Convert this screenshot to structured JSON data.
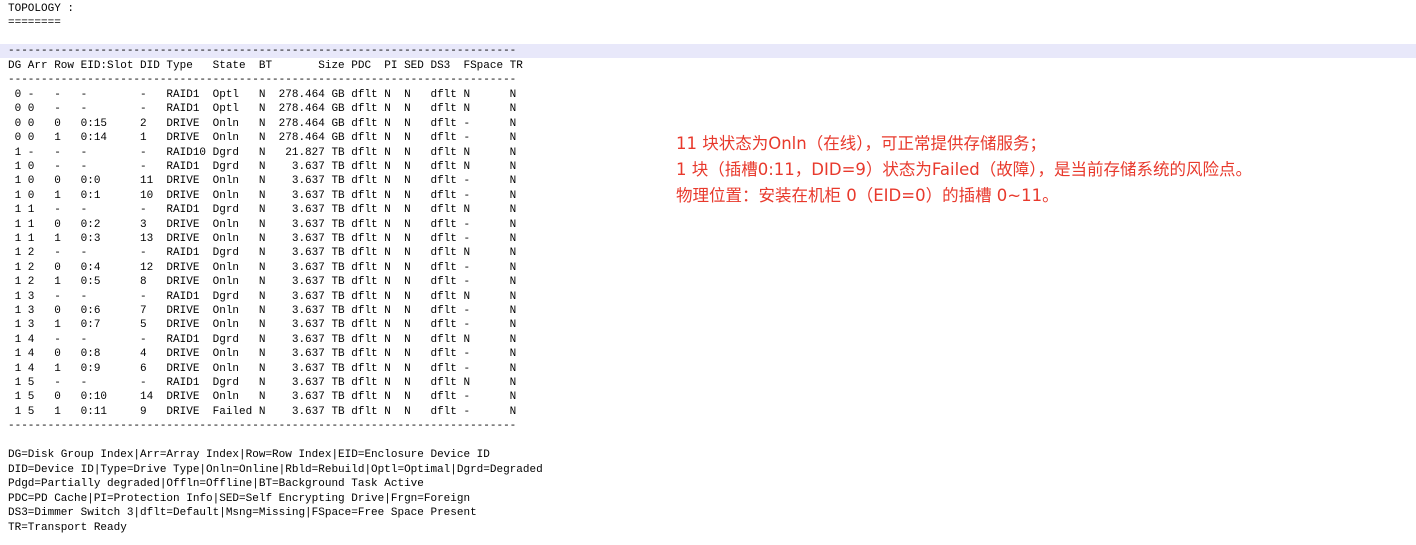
{
  "topology": {
    "heading": "TOPOLOGY :",
    "heading_underline": "========",
    "separator": "-----------------------------------------------------------------------------",
    "header_row": "DG Arr Row EID:Slot DID Type   State  BT       Size PDC  PI SED DS3  FSpace TR",
    "rows": [
      " 0 -   -   -        -   RAID1  Optl   N  278.464 GB dflt N  N   dflt N      N",
      " 0 0   -   -        -   RAID1  Optl   N  278.464 GB dflt N  N   dflt N      N",
      " 0 0   0   0:15     2   DRIVE  Onln   N  278.464 GB dflt N  N   dflt -      N",
      " 0 0   1   0:14     1   DRIVE  Onln   N  278.464 GB dflt N  N   dflt -      N",
      " 1 -   -   -        -   RAID10 Dgrd   N   21.827 TB dflt N  N   dflt N      N",
      " 1 0   -   -        -   RAID1  Dgrd   N    3.637 TB dflt N  N   dflt N      N",
      " 1 0   0   0:0      11  DRIVE  Onln   N    3.637 TB dflt N  N   dflt -      N",
      " 1 0   1   0:1      10  DRIVE  Onln   N    3.637 TB dflt N  N   dflt -      N",
      " 1 1   -   -        -   RAID1  Dgrd   N    3.637 TB dflt N  N   dflt N      N",
      " 1 1   0   0:2      3   DRIVE  Onln   N    3.637 TB dflt N  N   dflt -      N",
      " 1 1   1   0:3      13  DRIVE  Onln   N    3.637 TB dflt N  N   dflt -      N",
      " 1 2   -   -        -   RAID1  Dgrd   N    3.637 TB dflt N  N   dflt N      N",
      " 1 2   0   0:4      12  DRIVE  Onln   N    3.637 TB dflt N  N   dflt -      N",
      " 1 2   1   0:5      8   DRIVE  Onln   N    3.637 TB dflt N  N   dflt -      N",
      " 1 3   -   -        -   RAID1  Dgrd   N    3.637 TB dflt N  N   dflt N      N",
      " 1 3   0   0:6      7   DRIVE  Onln   N    3.637 TB dflt N  N   dflt -      N",
      " 1 3   1   0:7      5   DRIVE  Onln   N    3.637 TB dflt N  N   dflt -      N",
      " 1 4   -   -        -   RAID1  Dgrd   N    3.637 TB dflt N  N   dflt N      N",
      " 1 4   0   0:8      4   DRIVE  Onln   N    3.637 TB dflt N  N   dflt -      N",
      " 1 4   1   0:9      6   DRIVE  Onln   N    3.637 TB dflt N  N   dflt -      N",
      " 1 5   -   -        -   RAID1  Dgrd   N    3.637 TB dflt N  N   dflt N      N",
      " 1 5   0   0:10     14  DRIVE  Onln   N    3.637 TB dflt N  N   dflt -      N",
      " 1 5   1   0:11     9   DRIVE  Failed N    3.637 TB dflt N  N   dflt -      N"
    ],
    "legend": [
      "DG=Disk Group Index|Arr=Array Index|Row=Row Index|EID=Enclosure Device ID",
      "DID=Device ID|Type=Drive Type|Onln=Online|Rbld=Rebuild|Optl=Optimal|Dgrd=Degraded",
      "Pdgd=Partially degraded|Offln=Offline|BT=Background Task Active",
      "PDC=PD Cache|PI=Protection Info|SED=Self Encrypting Drive|Frgn=Foreign",
      "DS3=Dimmer Switch 3|dflt=Default|Msng=Missing|FSpace=Free Space Present",
      "TR=Transport Ready"
    ]
  },
  "annotations": [
    "11 块状态为Onln（在线），可正常提供存储服务；",
    "1 块（插槽0:11，DID=9）状态为Failed（故障），是当前存储系统的风险点。",
    "物理位置：安装在机柜 0（EID=0）的插槽 0~11。"
  ],
  "colors": {
    "annotation_text": "#e8392c",
    "highlight_line": "#e8e8fa",
    "text": "#000000"
  }
}
